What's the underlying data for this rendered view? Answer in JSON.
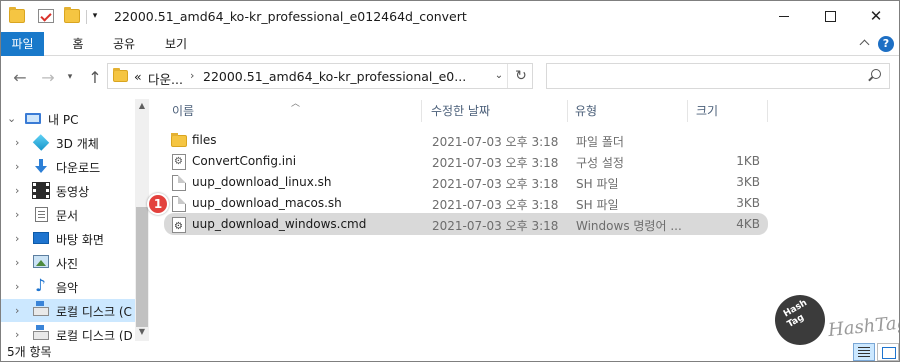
{
  "window": {
    "title": "22000.51_amd64_ko-kr_professional_e012464d_convert",
    "close_label": "✕"
  },
  "quick_access": {
    "dropdown_label": "▾"
  },
  "ribbon": {
    "tabs": [
      {
        "label": "파일"
      },
      {
        "label": "홈"
      },
      {
        "label": "공유"
      },
      {
        "label": "보기"
      }
    ],
    "help_label": "?"
  },
  "address": {
    "overflow": "«",
    "crumbs": [
      "다운...",
      "22000.51_amd64_ko-kr_professional_e0..."
    ],
    "separator": "›"
  },
  "search": {
    "placeholder": ""
  },
  "nav_pane": {
    "items": [
      {
        "label": "내 PC",
        "icon": "pc-icon"
      },
      {
        "label": "3D 개체",
        "icon": "3d-objects-icon"
      },
      {
        "label": "다운로드",
        "icon": "download-icon"
      },
      {
        "label": "동영상",
        "icon": "video-icon"
      },
      {
        "label": "문서",
        "icon": "document-icon"
      },
      {
        "label": "바탕 화면",
        "icon": "desktop-icon"
      },
      {
        "label": "사진",
        "icon": "picture-icon"
      },
      {
        "label": "음악",
        "icon": "music-icon"
      },
      {
        "label": "로컬 디스크 (C",
        "icon": "drive-icon"
      },
      {
        "label": "로컬 디스크 (D",
        "icon": "drive-icon"
      }
    ]
  },
  "columns": {
    "name": "이름",
    "modified": "수정한 날짜",
    "type": "유형",
    "size": "크기"
  },
  "files": [
    {
      "name": "files",
      "modified": "2021-07-03 오후 3:18",
      "type": "파일 폴더",
      "size": "",
      "icon": "folder-icon"
    },
    {
      "name": "ConvertConfig.ini",
      "modified": "2021-07-03 오후 3:18",
      "type": "구성 설정",
      "size": "1KB",
      "icon": "config-file-icon"
    },
    {
      "name": "uup_download_linux.sh",
      "modified": "2021-07-03 오후 3:18",
      "type": "SH 파일",
      "size": "3KB",
      "icon": "file-icon"
    },
    {
      "name": "uup_download_macos.sh",
      "modified": "2021-07-03 오후 3:18",
      "type": "SH 파일",
      "size": "3KB",
      "icon": "file-icon"
    },
    {
      "name": "uup_download_windows.cmd",
      "modified": "2021-07-03 오후 3:18",
      "type": "Windows 명령어 ...",
      "size": "4KB",
      "icon": "cmd-file-icon"
    }
  ],
  "annotation": {
    "step": "1"
  },
  "watermark": {
    "badge_top": "Hash",
    "badge_mid": "Tag",
    "badge_bot": "",
    "text": "HashTag"
  },
  "status": {
    "item_count": "5개 항목"
  },
  "colors": {
    "accent": "#1979ca",
    "selection": "#cce8ff",
    "badge": "#e3413d"
  }
}
